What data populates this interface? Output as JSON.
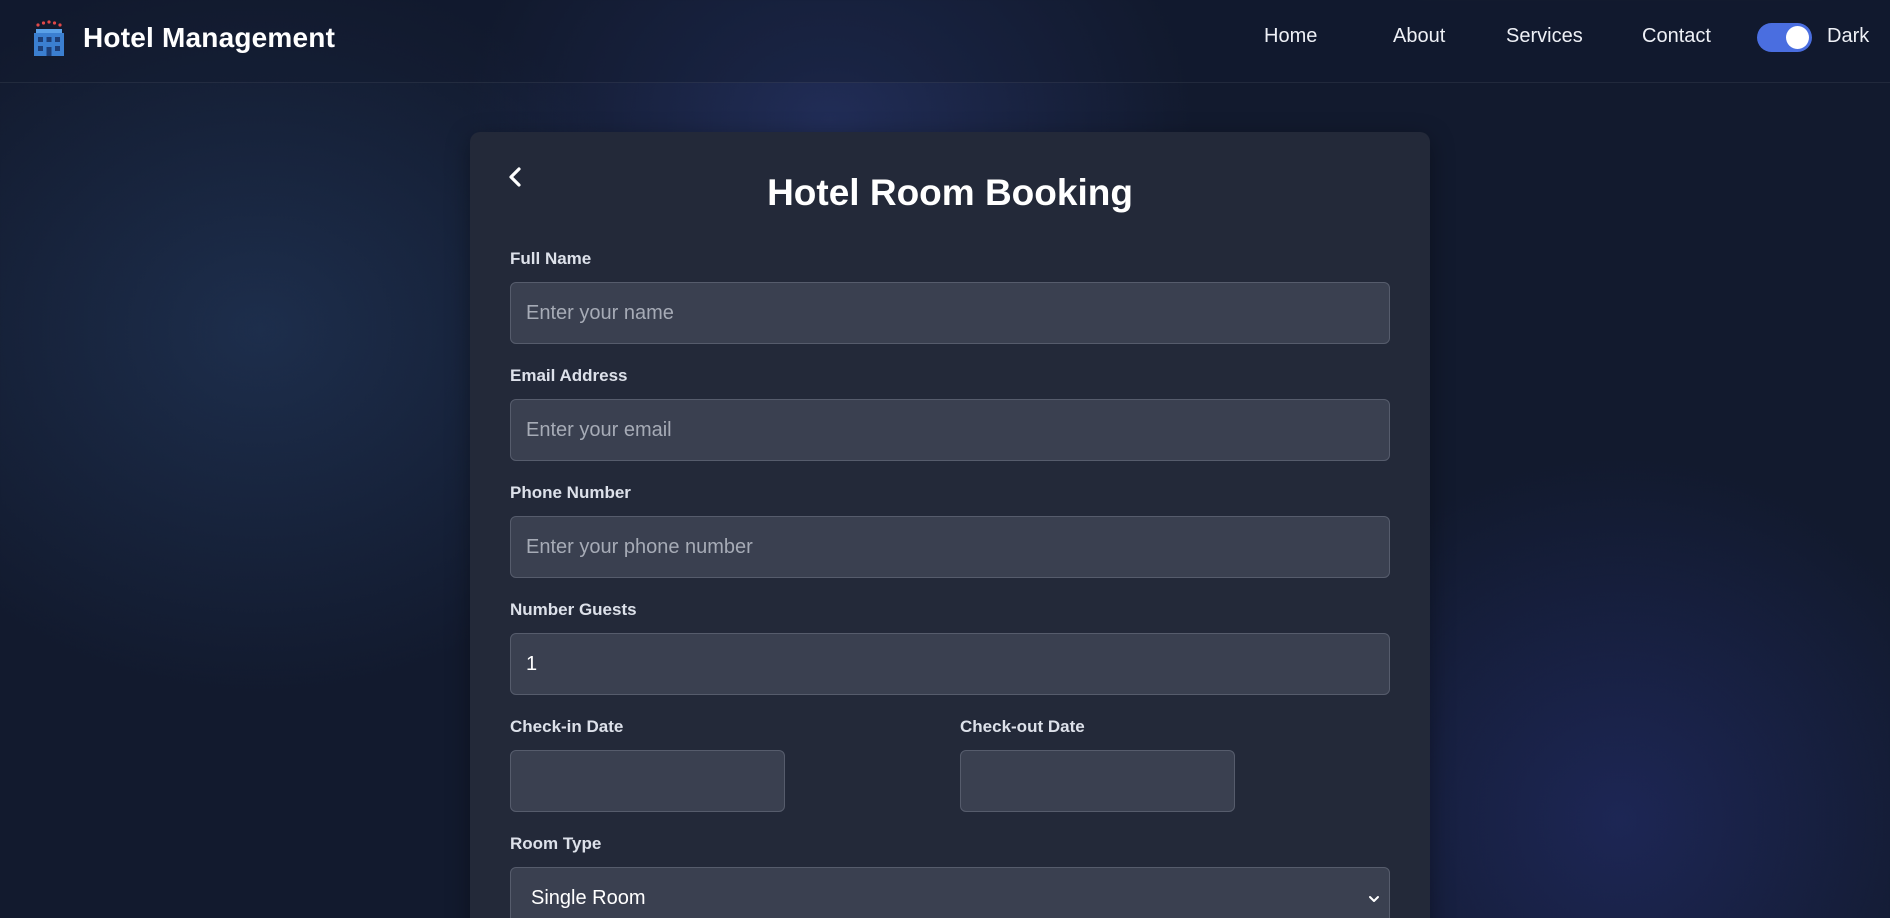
{
  "navbar": {
    "brand_title": "Hotel Management",
    "brand_icon": "hotel-building-icon",
    "links": [
      "Home",
      "About",
      "Services",
      "Contact"
    ],
    "theme_toggle": {
      "label": "Dark",
      "on": true
    }
  },
  "form": {
    "title": "Hotel Room Booking",
    "back_icon": "chevron-left-icon",
    "full_name": {
      "label": "Full Name",
      "placeholder": "Enter your name"
    },
    "email": {
      "label": "Email Address",
      "placeholder": "Enter your email"
    },
    "phone": {
      "label": "Phone Number",
      "placeholder": "Enter your phone number"
    },
    "guests": {
      "label": "Number Guests",
      "value": "1"
    },
    "check_in": {
      "label": "Check-in Date",
      "value": ""
    },
    "check_out": {
      "label": "Check-out Date",
      "value": ""
    },
    "room_type": {
      "label": "Room Type",
      "value": "Single Room"
    }
  },
  "colors": {
    "background": "#121a2e",
    "card": "#232939",
    "input": "#3a4050",
    "toggle_accent": "#4a6ee0"
  }
}
